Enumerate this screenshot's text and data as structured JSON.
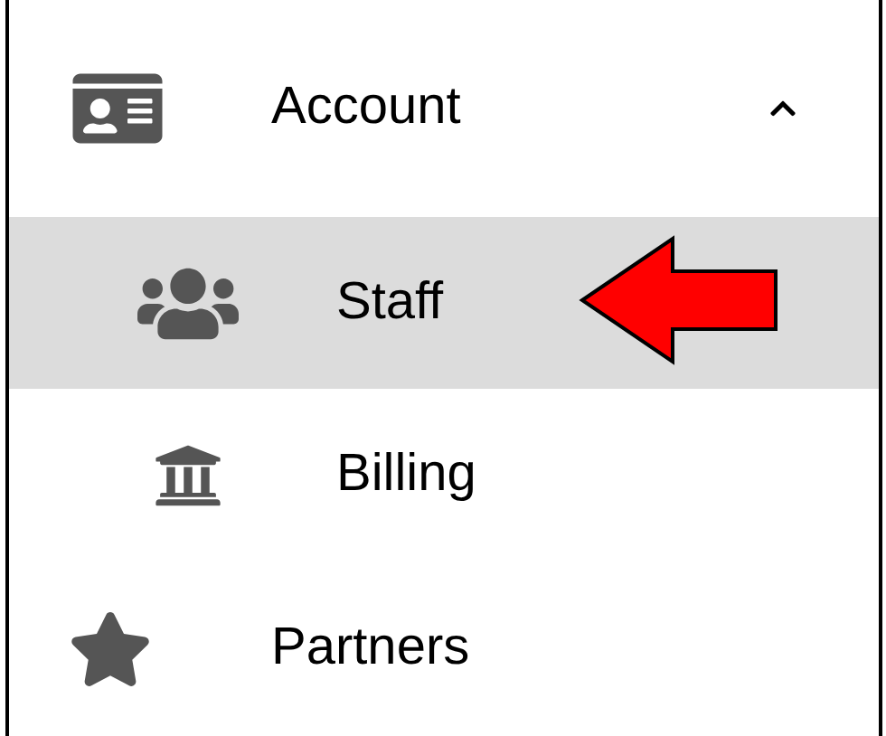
{
  "menu": [
    {
      "label": "Account",
      "kind": "group",
      "expanded": true,
      "children": [
        {
          "label": "Staff",
          "selected": true
        },
        {
          "label": "Billing",
          "selected": false
        }
      ]
    },
    {
      "label": "Partners",
      "kind": "link"
    }
  ]
}
